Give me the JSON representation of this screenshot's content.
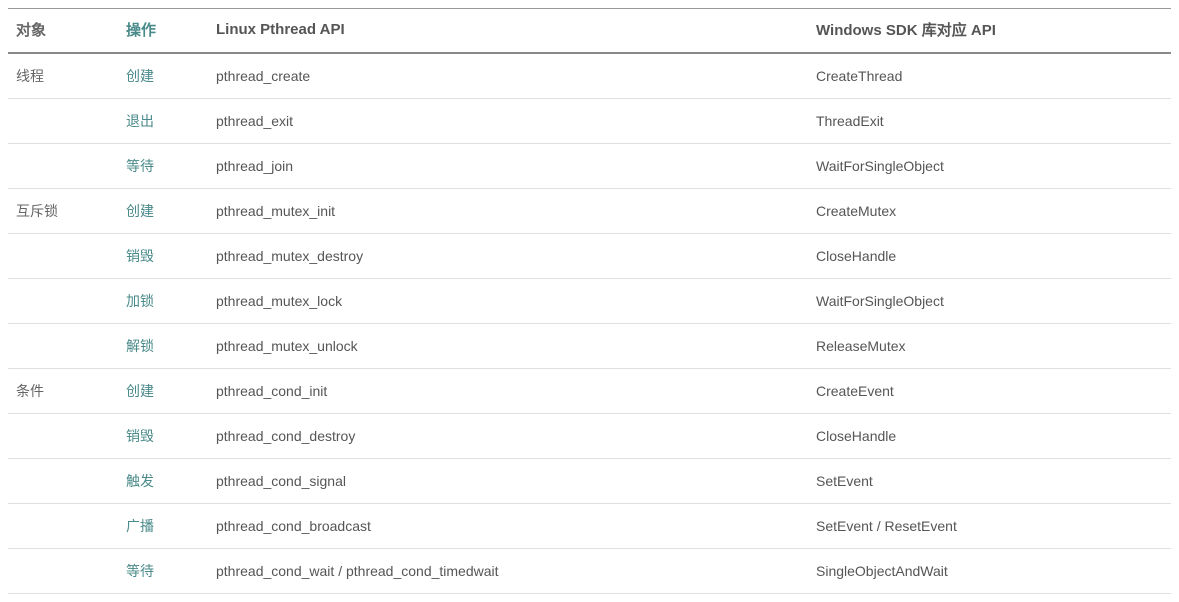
{
  "headers": {
    "object": "对象",
    "action": "操作",
    "linux": "Linux Pthread API",
    "windows": "Windows SDK 库对应 API"
  },
  "groups": [
    {
      "object": "线程",
      "rows": [
        {
          "action": "创建",
          "linux": "pthread_create",
          "windows": "CreateThread"
        },
        {
          "action": "退出",
          "linux": "pthread_exit",
          "windows": "ThreadExit"
        },
        {
          "action": "等待",
          "linux": "pthread_join",
          "windows": "WaitForSingleObject"
        }
      ]
    },
    {
      "object": "互斥锁",
      "rows": [
        {
          "action": "创建",
          "linux": "pthread_mutex_init",
          "windows": "CreateMutex"
        },
        {
          "action": "销毁",
          "linux": "pthread_mutex_destroy",
          "windows": "CloseHandle"
        },
        {
          "action": "加锁",
          "linux": "pthread_mutex_lock",
          "windows": "WaitForSingleObject"
        },
        {
          "action": "解锁",
          "linux": "pthread_mutex_unlock",
          "windows": "ReleaseMutex"
        }
      ]
    },
    {
      "object": "条件",
      "rows": [
        {
          "action": "创建",
          "linux": "pthread_cond_init",
          "windows": "CreateEvent"
        },
        {
          "action": "销毁",
          "linux": "pthread_cond_destroy",
          "windows": "CloseHandle"
        },
        {
          "action": "触发",
          "linux": "pthread_cond_signal",
          "windows": "SetEvent"
        },
        {
          "action": "广播",
          "linux": "pthread_cond_broadcast",
          "windows": "SetEvent / ResetEvent"
        },
        {
          "action": "等待",
          "linux": "pthread_cond_wait / pthread_cond_timedwait",
          "windows": "SingleObjectAndWait"
        }
      ]
    }
  ]
}
